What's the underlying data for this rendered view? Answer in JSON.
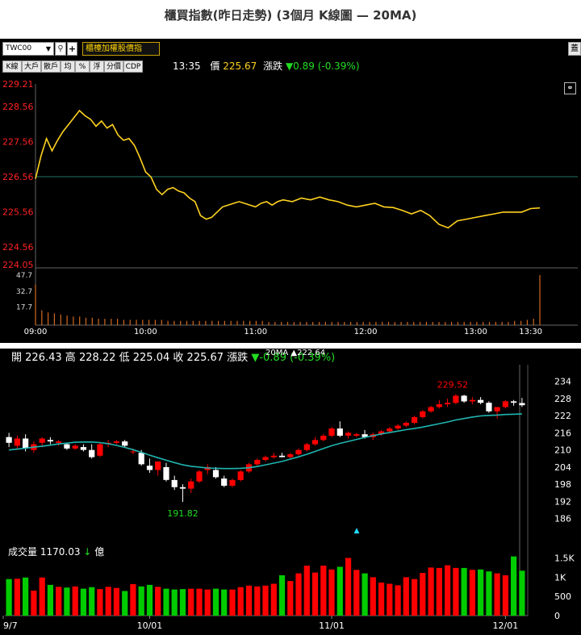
{
  "title": "櫃買指數(昨日走勢) (3個月 K線圖 — 20MA)",
  "toolbar": {
    "symbol_value": "TWC00",
    "label": "櫃檯加權股價指",
    "right_label": "蓋",
    "buttons": [
      "K線",
      "大戶",
      "散戶",
      "均",
      "%",
      "浮",
      "分價",
      "CDP"
    ]
  },
  "intraday_quote": {
    "time": "13:35",
    "price_label": "價",
    "price": "225.67",
    "change_label": "漲跌",
    "change": "▼0.89 (-0.39%)"
  },
  "daily_quote": {
    "open_label": "開",
    "open": "226.43",
    "high_label": "高",
    "high": "228.22",
    "low_label": "低",
    "low": "225.04",
    "close_label": "收",
    "close": "225.67",
    "change_label": "漲跌",
    "change": "▼-0.89 (-0.39%)",
    "ma_label": "20MA",
    "ma_value": "▲222.64",
    "volume_label": "成交量",
    "volume_value": "1170.03",
    "volume_unit": "億"
  },
  "colors": {
    "up": "#ff0000",
    "down": "#00cc00",
    "intraday_line": "#ffd21f",
    "ma_line": "#1fb5b0",
    "volume_bar": "#d2691e",
    "ref_line": "#1f7a64",
    "axis_red": "#ff2222",
    "background": "#000000"
  },
  "chart_data": [
    {
      "type": "line",
      "title": "",
      "ylim": [
        224.05,
        229.21
      ],
      "yticks": [
        "229.21",
        "228.56",
        "227.56",
        "226.56",
        "225.56",
        "224.56",
        "224.05"
      ],
      "reference": 226.56,
      "xticks": [
        "09:00",
        "10:00",
        "11:00",
        "12:00",
        "13:00",
        "13:30"
      ],
      "xlim_minutes": [
        0,
        275
      ],
      "series": [
        {
          "x": [
            0,
            3,
            6,
            9,
            12,
            15,
            18,
            21,
            24,
            27,
            30,
            33,
            36,
            39,
            42,
            45,
            48,
            51,
            54,
            57,
            60,
            63,
            66,
            69,
            72,
            75,
            78,
            81,
            84,
            87,
            90,
            93,
            96,
            99,
            102,
            105,
            108,
            111,
            114,
            117,
            120,
            123,
            126,
            129,
            132,
            135,
            140,
            145,
            150,
            155,
            160,
            165,
            170,
            175,
            180,
            185,
            190,
            195,
            200,
            205,
            210,
            215,
            220,
            225,
            230,
            235,
            240,
            245,
            250,
            255,
            260,
            265,
            270,
            275
          ],
          "y": [
            226.5,
            227.15,
            227.65,
            227.3,
            227.6,
            227.85,
            228.05,
            228.25,
            228.45,
            228.3,
            228.2,
            228.0,
            228.15,
            227.95,
            228.05,
            227.75,
            227.6,
            227.65,
            227.45,
            227.1,
            226.7,
            226.55,
            226.2,
            226.05,
            226.2,
            226.25,
            226.15,
            226.1,
            225.95,
            225.85,
            225.45,
            225.35,
            225.4,
            225.55,
            225.7,
            225.75,
            225.8,
            225.85,
            225.8,
            225.75,
            225.7,
            225.8,
            225.85,
            225.75,
            225.85,
            225.9,
            225.85,
            225.95,
            225.9,
            225.98,
            225.9,
            225.85,
            225.75,
            225.7,
            225.75,
            225.8,
            225.7,
            225.68,
            225.6,
            225.5,
            225.6,
            225.45,
            225.2,
            225.1,
            225.3,
            225.35,
            225.4,
            225.45,
            225.5,
            225.55,
            225.55,
            225.55,
            225.65,
            225.67
          ]
        }
      ]
    },
    {
      "type": "bar",
      "title": "",
      "ylim": [
        0,
        47.7
      ],
      "yticks": [
        "47.7",
        "32.7",
        "17.7"
      ],
      "note": "intraday minute volume",
      "values": [
        38,
        14,
        12,
        11,
        10,
        9,
        8,
        8,
        7,
        7,
        6,
        6,
        6,
        6,
        5,
        5,
        5,
        5,
        5,
        5,
        5,
        4,
        4,
        4,
        4,
        4,
        4,
        4,
        4,
        4,
        4,
        4,
        4,
        4,
        4,
        4,
        4,
        3,
        3,
        3,
        3,
        3,
        3,
        3,
        3,
        3,
        3,
        3,
        3,
        3,
        3,
        3,
        3,
        3,
        3,
        3,
        3,
        3,
        3,
        3,
        3,
        3,
        3,
        3,
        3,
        3,
        3,
        3,
        3,
        3,
        3,
        3,
        3,
        3,
        3,
        3,
        4,
        4,
        5,
        6,
        47
      ]
    },
    {
      "type": "candlestick",
      "title": "",
      "ylim": [
        180,
        237
      ],
      "yticks": [
        "234",
        "228",
        "222",
        "216",
        "210",
        "204",
        "198",
        "192",
        "186"
      ],
      "xticks": [
        "9/7",
        "10/01",
        "11/01",
        "12/01"
      ],
      "annotations": [
        "229.52",
        "191.82"
      ],
      "candles": [
        [
          214.5,
          216.0,
          211.0,
          212.5
        ],
        [
          211.5,
          215.0,
          210.0,
          214.0
        ],
        [
          214.0,
          215.5,
          209.5,
          210.5
        ],
        [
          210.0,
          213.0,
          209.0,
          212.0
        ],
        [
          212.5,
          214.5,
          211.0,
          214.0
        ],
        [
          213.5,
          214.5,
          212.0,
          213.0
        ],
        [
          212.5,
          213.5,
          211.5,
          213.0
        ],
        [
          212.0,
          212.5,
          210.0,
          210.5
        ],
        [
          210.5,
          212.0,
          210.0,
          211.5
        ],
        [
          211.0,
          212.0,
          209.5,
          210.0
        ],
        [
          210.0,
          212.0,
          207.0,
          207.5
        ],
        [
          208.0,
          212.5,
          207.5,
          212.0
        ],
        [
          212.0,
          213.5,
          211.0,
          212.5
        ],
        [
          212.5,
          213.5,
          212.0,
          213.0
        ],
        [
          213.0,
          213.5,
          211.0,
          211.5
        ],
        [
          209.5,
          210.5,
          208.5,
          209.5
        ],
        [
          209.0,
          210.0,
          204.5,
          205.0
        ],
        [
          204.5,
          207.0,
          202.0,
          203.0
        ],
        [
          203.0,
          206.0,
          201.0,
          206.0
        ],
        [
          204.0,
          205.5,
          199.0,
          199.5
        ],
        [
          199.5,
          201.0,
          196.0,
          197.0
        ],
        [
          197.0,
          198.0,
          191.82,
          196.5
        ],
        [
          196.5,
          200.0,
          195.0,
          199.0
        ],
        [
          199.0,
          203.0,
          198.5,
          202.5
        ],
        [
          203.0,
          205.0,
          201.5,
          204.0
        ],
        [
          203.0,
          204.0,
          200.0,
          200.5
        ],
        [
          200.0,
          201.0,
          197.0,
          197.5
        ],
        [
          197.5,
          200.0,
          197.0,
          199.5
        ],
        [
          199.5,
          203.0,
          199.0,
          202.5
        ],
        [
          202.5,
          205.5,
          202.0,
          205.0
        ],
        [
          205.0,
          207.0,
          204.5,
          206.5
        ],
        [
          206.5,
          208.0,
          206.0,
          207.5
        ],
        [
          207.5,
          209.0,
          207.0,
          208.0
        ],
        [
          208.0,
          209.0,
          207.5,
          207.5
        ],
        [
          207.5,
          209.0,
          207.0,
          208.5
        ],
        [
          208.5,
          210.5,
          208.0,
          210.0
        ],
        [
          210.0,
          212.5,
          209.5,
          212.0
        ],
        [
          212.0,
          214.5,
          211.5,
          213.5
        ],
        [
          213.5,
          215.5,
          213.0,
          215.0
        ],
        [
          215.0,
          218.0,
          214.5,
          217.5
        ],
        [
          217.5,
          220.0,
          214.5,
          215.0
        ],
        [
          215.0,
          216.5,
          214.0,
          216.0
        ],
        [
          215.0,
          216.0,
          214.5,
          215.5
        ],
        [
          215.5,
          217.0,
          214.0,
          214.5
        ],
        [
          214.5,
          216.0,
          213.5,
          215.5
        ],
        [
          215.5,
          217.0,
          215.0,
          216.5
        ],
        [
          216.5,
          218.0,
          216.0,
          217.5
        ],
        [
          217.5,
          219.0,
          217.0,
          218.5
        ],
        [
          218.5,
          220.0,
          218.0,
          219.5
        ],
        [
          219.5,
          222.0,
          219.0,
          221.5
        ],
        [
          221.5,
          224.0,
          221.0,
          223.5
        ],
        [
          223.5,
          225.5,
          223.0,
          225.0
        ],
        [
          225.0,
          227.5,
          224.5,
          226.0
        ],
        [
          226.0,
          228.0,
          225.0,
          226.5
        ],
        [
          226.5,
          229.52,
          226.0,
          229.0
        ],
        [
          229.0,
          229.3,
          226.5,
          227.0
        ],
        [
          227.0,
          228.5,
          226.0,
          227.5
        ],
        [
          227.5,
          228.5,
          226.0,
          226.5
        ],
        [
          226.5,
          227.0,
          223.0,
          223.5
        ],
        [
          223.5,
          225.0,
          221.0,
          225.0
        ],
        [
          225.0,
          227.5,
          224.5,
          227.0
        ],
        [
          227.0,
          227.5,
          225.5,
          226.5
        ],
        [
          226.43,
          228.22,
          225.04,
          225.67
        ]
      ],
      "ma20": [
        210.0,
        210.3,
        210.6,
        211.0,
        211.3,
        211.7,
        212.1,
        212.4,
        212.7,
        212.8,
        212.8,
        212.6,
        212.2,
        211.6,
        210.9,
        210.1,
        209.2,
        208.2,
        207.3,
        206.4,
        205.6,
        204.8,
        204.3,
        204.0,
        203.7,
        203.6,
        203.5,
        203.5,
        203.6,
        203.8,
        204.2,
        204.8,
        205.4,
        206.0,
        206.8,
        207.6,
        208.5,
        209.5,
        210.5,
        211.5,
        212.3,
        213.0,
        213.7,
        214.4,
        215.0,
        215.6,
        216.1,
        216.6,
        217.1,
        217.5,
        218.0,
        218.6,
        219.2,
        219.8,
        220.5,
        221.0,
        221.5,
        221.9,
        222.1,
        222.2,
        222.4,
        222.5,
        222.64
      ]
    },
    {
      "type": "bar",
      "title": "",
      "ylim": [
        0,
        1700
      ],
      "yticks": [
        "1.5K",
        "1K",
        "500",
        "0"
      ],
      "values": [
        950,
        960,
        990,
        650,
        990,
        800,
        750,
        730,
        760,
        700,
        740,
        690,
        750,
        720,
        640,
        820,
        760,
        800,
        750,
        700,
        680,
        690,
        700,
        700,
        680,
        700,
        680,
        680,
        740,
        780,
        760,
        780,
        830,
        1050,
        900,
        1100,
        1300,
        1120,
        1300,
        1200,
        1270,
        1500,
        1190,
        1100,
        1000,
        860,
        830,
        790,
        1000,
        950,
        1110,
        1250,
        1240,
        1310,
        1240,
        1240,
        1190,
        1200,
        1150,
        1100,
        1050,
        1540,
        1170
      ]
    }
  ]
}
